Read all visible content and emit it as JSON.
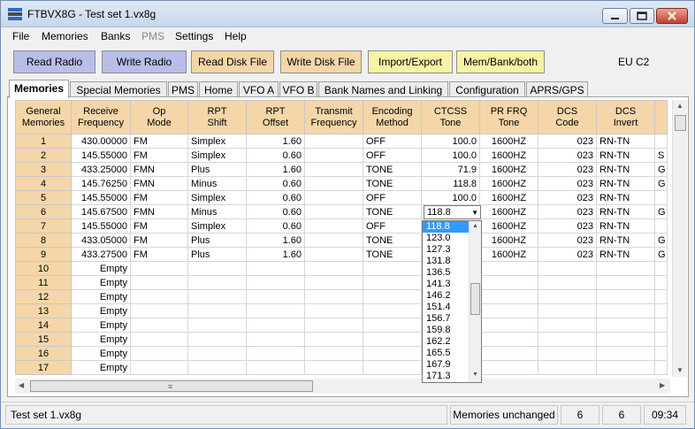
{
  "window": {
    "title": "FTBVX8G - Test set 1.vx8g"
  },
  "menu": [
    {
      "label": "File",
      "enabled": true
    },
    {
      "label": "Memories",
      "enabled": true
    },
    {
      "label": "Banks",
      "enabled": true
    },
    {
      "label": "PMS",
      "enabled": false
    },
    {
      "label": "Settings",
      "enabled": true
    },
    {
      "label": "Help",
      "enabled": true
    }
  ],
  "toolbar": {
    "read_radio": "Read Radio",
    "write_radio": "Write Radio",
    "read_disk": "Read Disk File",
    "write_disk": "Write Disk File",
    "import_export": "Import/Export",
    "mem_bank": "Mem/Bank/both",
    "region": "EU C2"
  },
  "tabs": [
    "Memories",
    "Special Memories",
    "PMS",
    "Home",
    "VFO A",
    "VFO B",
    "Bank Names and Linking",
    "Configuration",
    "APRS/GPS"
  ],
  "columns": [
    [
      "General",
      "Memories"
    ],
    [
      "Receive",
      "Frequency"
    ],
    [
      "Op",
      "Mode"
    ],
    [
      "RPT",
      "Shift"
    ],
    [
      "RPT",
      "Offset"
    ],
    [
      "Transmit",
      "Frequency"
    ],
    [
      "Encoding",
      "Method"
    ],
    [
      "CTCSS",
      "Tone"
    ],
    [
      "PR FRQ",
      "Tone"
    ],
    [
      "DCS",
      "Code"
    ],
    [
      "DCS",
      "Invert"
    ],
    [
      "",
      ""
    ]
  ],
  "rows": [
    [
      "1",
      "430.00000",
      "FM",
      "Simplex",
      "1.60",
      "",
      "OFF",
      "100.0",
      "1600HZ",
      "023",
      "RN-TN",
      ""
    ],
    [
      "2",
      "145.55000",
      "FM",
      "Simplex",
      "0.60",
      "",
      "OFF",
      "100.0",
      "1600HZ",
      "023",
      "RN-TN",
      "S"
    ],
    [
      "3",
      "433.25000",
      "FMN",
      "Plus",
      "1.60",
      "",
      "TONE",
      "71.9",
      "1600HZ",
      "023",
      "RN-TN",
      "G"
    ],
    [
      "4",
      "145.76250",
      "FMN",
      "Minus",
      "0.60",
      "",
      "TONE",
      "118.8",
      "1600HZ",
      "023",
      "RN-TN",
      "G"
    ],
    [
      "5",
      "145.55000",
      "FM",
      "Simplex",
      "0.60",
      "",
      "OFF",
      "100.0",
      "1600HZ",
      "023",
      "RN-TN",
      ""
    ],
    [
      "6",
      "145.67500",
      "FMN",
      "Minus",
      "0.60",
      "",
      "TONE",
      "",
      "1600HZ",
      "023",
      "RN-TN",
      "G"
    ],
    [
      "7",
      "145.55000",
      "FM",
      "Simplex",
      "0.60",
      "",
      "OFF",
      "",
      "1600HZ",
      "023",
      "RN-TN",
      ""
    ],
    [
      "8",
      "433.05000",
      "FM",
      "Plus",
      "1.60",
      "",
      "TONE",
      "",
      "1600HZ",
      "023",
      "RN-TN",
      "G"
    ],
    [
      "9",
      "433.27500",
      "FM",
      "Plus",
      "1.60",
      "",
      "TONE",
      "",
      "1600HZ",
      "023",
      "RN-TN",
      "G"
    ],
    [
      "10",
      "Empty",
      "",
      "",
      "",
      "",
      "",
      "",
      "",
      "",
      "",
      ""
    ],
    [
      "11",
      "Empty",
      "",
      "",
      "",
      "",
      "",
      "",
      "",
      "",
      "",
      ""
    ],
    [
      "12",
      "Empty",
      "",
      "",
      "",
      "",
      "",
      "",
      "",
      "",
      "",
      ""
    ],
    [
      "13",
      "Empty",
      "",
      "",
      "",
      "",
      "",
      "",
      "",
      "",
      "",
      ""
    ],
    [
      "14",
      "Empty",
      "",
      "",
      "",
      "",
      "",
      "",
      "",
      "",
      "",
      ""
    ],
    [
      "15",
      "Empty",
      "",
      "",
      "",
      "",
      "",
      "",
      "",
      "",
      "",
      ""
    ],
    [
      "16",
      "Empty",
      "",
      "",
      "",
      "",
      "",
      "",
      "",
      "",
      "",
      ""
    ],
    [
      "17",
      "Empty",
      "",
      "",
      "",
      "",
      "",
      "",
      "",
      "",
      "",
      ""
    ]
  ],
  "ctcss_combo": {
    "value": "118.8",
    "options": [
      "118.8",
      "123.0",
      "127.3",
      "131.8",
      "136.5",
      "141.3",
      "146.2",
      "151.4",
      "156.7",
      "159.8",
      "162.2",
      "165.5",
      "167.9",
      "171.3"
    ],
    "selected_index": 0
  },
  "status": {
    "file": "Test set 1.vx8g",
    "state": "Memories unchanged",
    "field1": "6",
    "field2": "6",
    "time": "09:34"
  },
  "icons": {
    "scroll_up": "▲",
    "scroll_down": "▼",
    "scroll_left": "◀",
    "scroll_right": "▶",
    "grip": "≡",
    "caret": "▼"
  }
}
